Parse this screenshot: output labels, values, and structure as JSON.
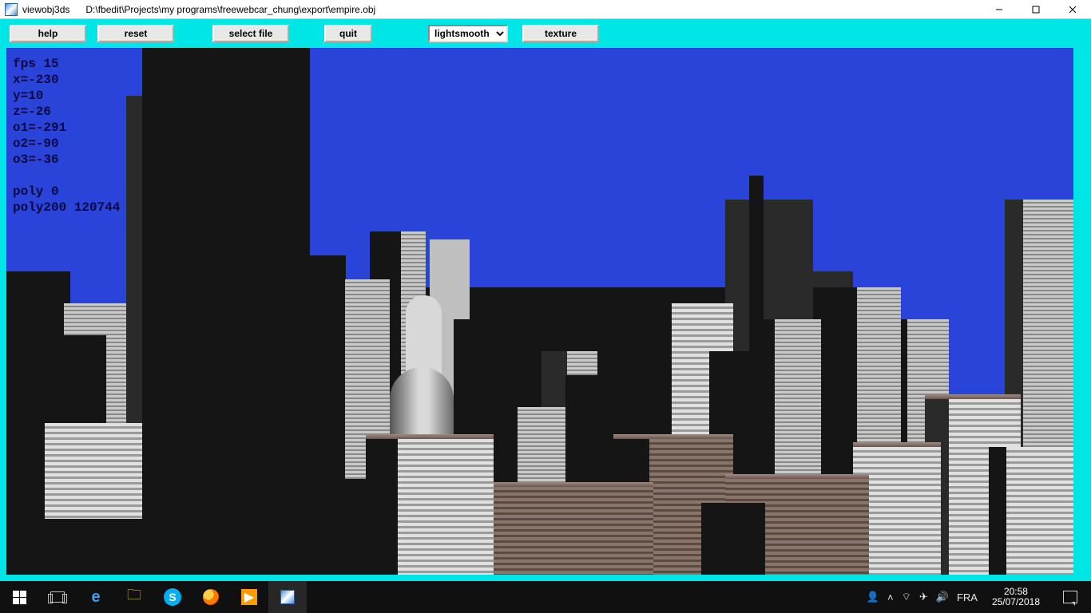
{
  "titlebar": {
    "app_name": "viewobj3ds",
    "file_path": "D:\\fbedit\\Projects\\my programs\\freewebcar_chung\\export\\empire.obj"
  },
  "toolbar": {
    "help_label": "help",
    "reset_label": "reset",
    "select_file_label": "select file",
    "quit_label": "quit",
    "render_mode_label": "lightsmooth",
    "texture_label": "texture"
  },
  "overlay": {
    "lines": [
      "fps 15",
      "x=-230",
      "y=10",
      "z=-26",
      "o1=-291",
      "o2=-90",
      "o3=-36",
      "",
      "poly 0",
      "poly200 120744"
    ]
  },
  "taskbar": {
    "lang": "FRA",
    "time": "20:58",
    "date": "25/07/2018"
  }
}
